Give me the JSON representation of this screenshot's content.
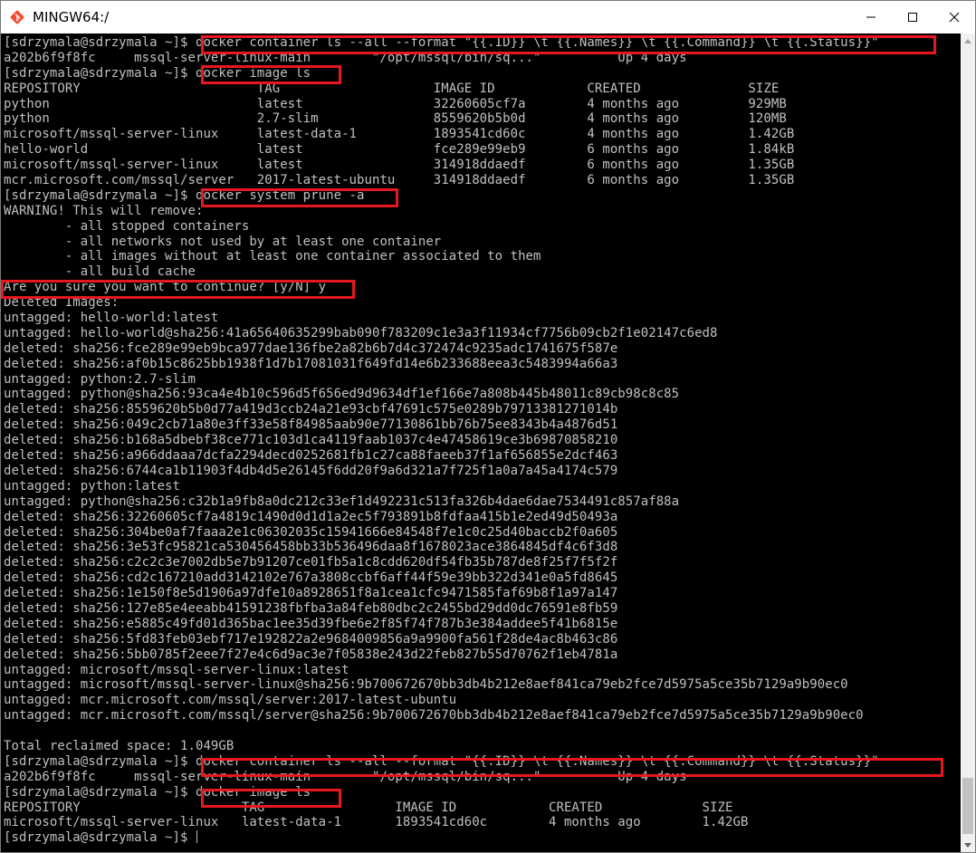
{
  "window": {
    "title": "MINGW64:/"
  },
  "terminal": {
    "lines": [
      "[sdrzymala@sdrzymala ~]$ docker container ls --all --format \"{{.ID}} \\t {{.Names}} \\t {{.Command}} \\t {{.Status}}\"",
      "a202b6f9f8fc     mssql-server-linux-main        \"/opt/mssql/bin/sq...\"          Up 4 days",
      "[sdrzymala@sdrzymala ~]$ docker image ls",
      "REPOSITORY                       TAG                    IMAGE ID            CREATED              SIZE",
      "python                           latest                 32260605cf7a        4 months ago         929MB",
      "python                           2.7-slim               8559620b5b0d        4 months ago         120MB",
      "microsoft/mssql-server-linux     latest-data-1          1893541cd60c        4 months ago         1.42GB",
      "hello-world                      latest                 fce289e99eb9        6 months ago         1.84kB",
      "microsoft/mssql-server-linux     latest                 314918ddaedf        6 months ago         1.35GB",
      "mcr.microsoft.com/mssql/server   2017-latest-ubuntu     314918ddaedf        6 months ago         1.35GB",
      "[sdrzymala@sdrzymala ~]$ docker system prune -a",
      "WARNING! This will remove:",
      "        - all stopped containers",
      "        - all networks not used by at least one container",
      "        - all images without at least one container associated to them",
      "        - all build cache",
      "Are you sure you want to continue? [y/N] y",
      "Deleted Images:",
      "untagged: hello-world:latest",
      "untagged: hello-world@sha256:41a65640635299bab090f783209c1e3a3f11934cf7756b09cb2f1e02147c6ed8",
      "deleted: sha256:fce289e99eb9bca977dae136fbe2a82b6b7d4c372474c9235adc1741675f587e",
      "deleted: sha256:af0b15c8625bb1938f1d7b17081031f649fd14e6b233688eea3c5483994a66a3",
      "untagged: python:2.7-slim",
      "untagged: python@sha256:93ca4e4b10c596d5f656ed9d9634df1ef166e7a808b445b48011c89cb98c8c85",
      "deleted: sha256:8559620b5b0d77a419d3ccb24a21e93cbf47691c575e0289b79713381271014b",
      "deleted: sha256:049c2cb71a80e3ff33e58f84985aab90e77130861bb76b75ee8343b4a4876d51",
      "deleted: sha256:b168a5dbebf38ce771c103d1ca4119faab1037c4e47458619ce3b69870858210",
      "deleted: sha256:a966ddaaa7dcfa2294decd0252681fb1c27ca88faeeb37f1af656855e2dcf463",
      "deleted: sha256:6744ca1b11903f4db4d5e26145f6dd20f9a6d321a7f725f1a0a7a45a4174c579",
      "untagged: python:latest",
      "untagged: python@sha256:c32b1a9fb8a0dc212c33ef1d492231c513fa326b4dae6dae7534491c857af88a",
      "deleted: sha256:32260605cf7a4819c1490d0d1d1a2ec5f793891b8fdfaa415b1e2ed49d50493a",
      "deleted: sha256:304be0af7faaa2e1c06302035c15941666e84548f7e1c0c25d40baccb2f0a605",
      "deleted: sha256:3e53fc95821ca530456458bb33b536496daa8f1678023ace3864845df4c6f3d8",
      "deleted: sha256:c2c2c3e7002db5e7b91207ce01fb5a1c8cdd620df54fb35b787de8f25f7f5f2f",
      "deleted: sha256:cd2c167210add3142102e767a3808ccbf6aff44f59e39bb322d341e0a5fd8645",
      "deleted: sha256:1e150f8e5d1906a97dfe10a8928651f8a1cea1cfc9471585faf69b8f1a97a147",
      "deleted: sha256:127e85e4eeabb41591238fbfba3a84feb80dbc2c2455bd29dd0dc76591e8fb59",
      "deleted: sha256:e5885c49fd01d365bac1ee35d39fbe6e2f85f74f787b3e384addee5f41b6815e",
      "deleted: sha256:5fd83feb03ebf717e192822a2e9684009856a9a9900fa561f28de4ac8b463c86",
      "deleted: sha256:5bb0785f2eee7f27e4c6d9ac3e7f05838e243d22feb827b55d70762f1eb4781a",
      "untagged: microsoft/mssql-server-linux:latest",
      "untagged: microsoft/mssql-server-linux@sha256:9b700672670bb3db4b212e8aef841ca79eb2fce7d5975a5ce35b7129a9b90ec0",
      "untagged: mcr.microsoft.com/mssql/server:2017-latest-ubuntu",
      "untagged: mcr.microsoft.com/mssql/server@sha256:9b700672670bb3db4b212e8aef841ca79eb2fce7d5975a5ce35b7129a9b90ec0",
      "",
      "Total reclaimed space: 1.049GB",
      "[sdrzymala@sdrzymala ~]$ docker container ls --all --format \"{{.ID}} \\t {{.Names}} \\t {{.Command}} \\t {{.Status}}\"",
      "a202b6f9f8fc     mssql-server-linux-main        \"/opt/mssql/bin/sq...\"          Up 4 days",
      "[sdrzymala@sdrzymala ~]$ docker image ls",
      "REPOSITORY                     TAG                 IMAGE ID            CREATED             SIZE",
      "microsoft/mssql-server-linux   latest-data-1       1893541cd60c        4 months ago        1.42GB",
      "[sdrzymala@sdrzymala ~]$ "
    ]
  },
  "icons": {
    "app": "git-bash-icon",
    "minimize": "minimize-icon",
    "maximize": "maximize-icon",
    "close": "close-icon"
  },
  "colors": {
    "terminal_bg": "#000000",
    "terminal_text": "#c0c0c0",
    "highlight_border": "#e8171f",
    "app_icon": "#f05033"
  }
}
